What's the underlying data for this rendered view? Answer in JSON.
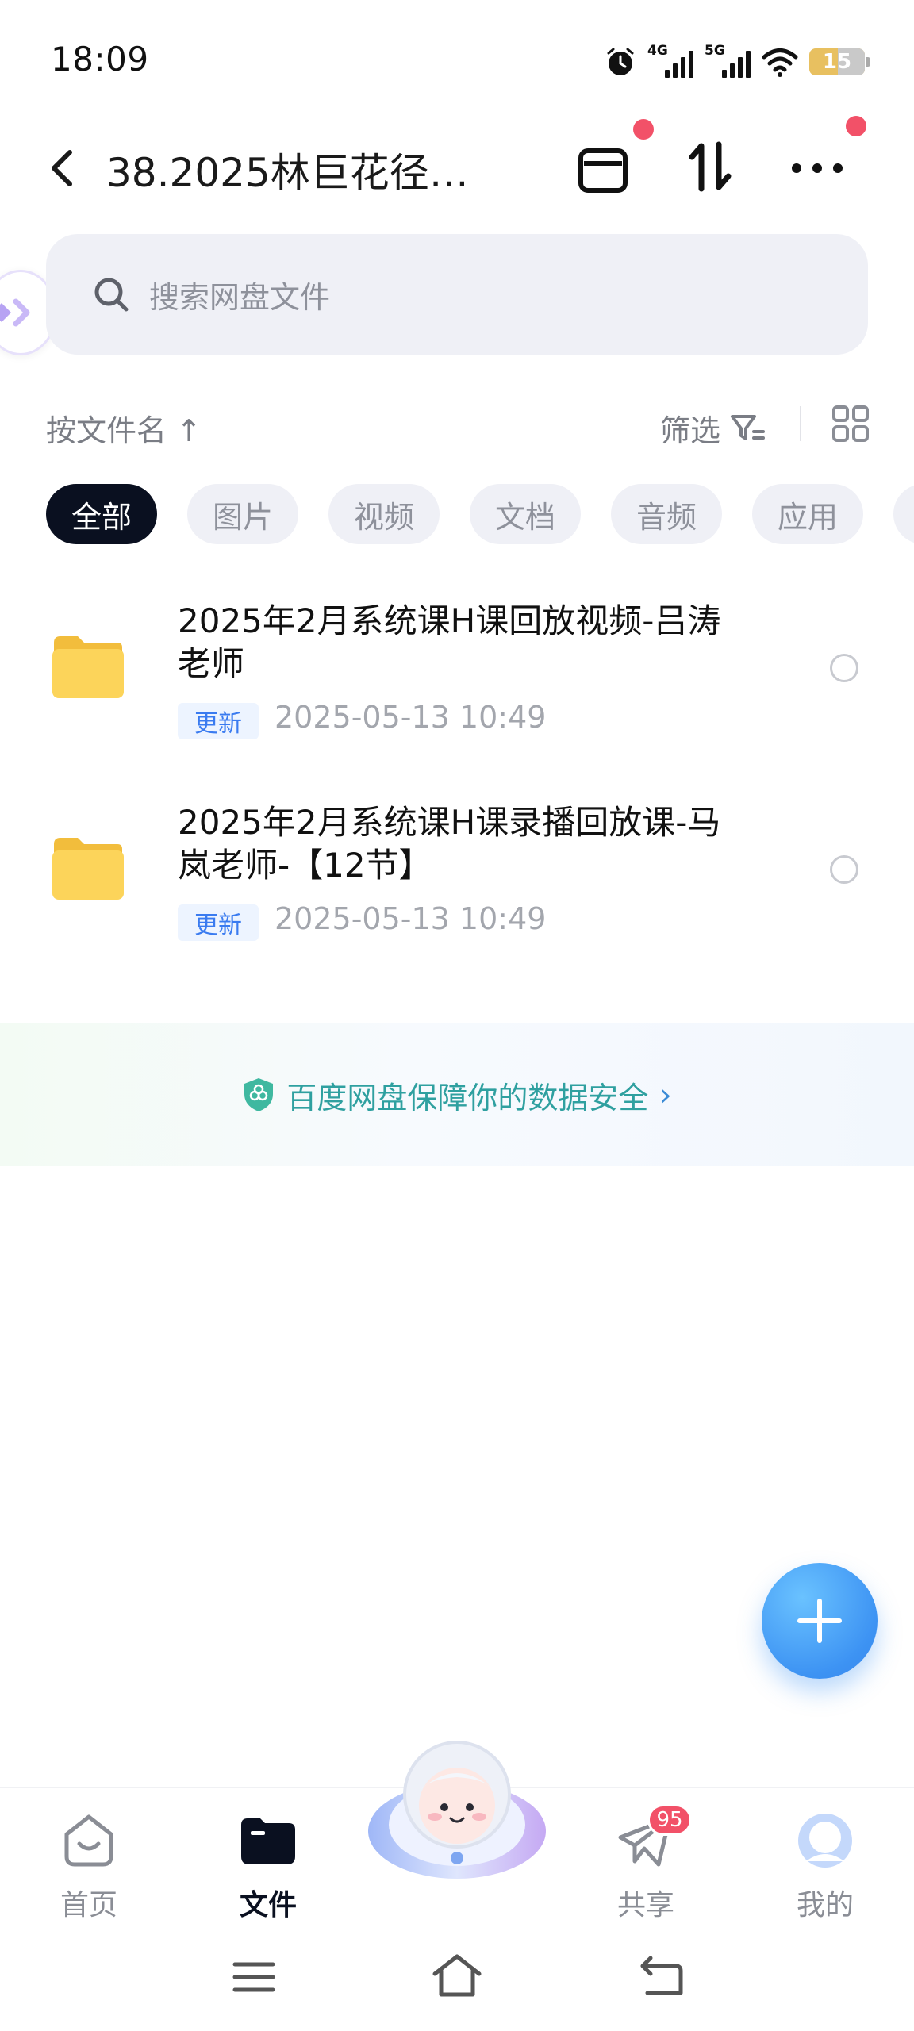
{
  "status_bar": {
    "time": "18:09",
    "signal_1_tag": "4G",
    "signal_2_tag": "5G",
    "battery": "15"
  },
  "header": {
    "title": "38.2025林巨花径…"
  },
  "search": {
    "placeholder": "搜索网盘文件"
  },
  "toolbar": {
    "sort_label": "按文件名 ↑",
    "filter_label": "筛选"
  },
  "chips": [
    {
      "label": "全部",
      "active": true
    },
    {
      "label": "图片",
      "active": false
    },
    {
      "label": "视频",
      "active": false
    },
    {
      "label": "文档",
      "active": false
    },
    {
      "label": "音频",
      "active": false
    },
    {
      "label": "应用",
      "active": false
    }
  ],
  "files": [
    {
      "name_line1": "2025年2月系统课H课回放视频-吕涛",
      "name_line2": "老师",
      "badge": "更新",
      "time": "2025-05-13  10:49"
    },
    {
      "name_line1": "2025年2月系统课H课录播回放课-马",
      "name_line2": "岚老师-【12节】",
      "badge": "更新",
      "time": "2025-05-13  10:49"
    }
  ],
  "security_banner": {
    "text": "百度网盘保障你的数据安全",
    "chevron": "›"
  },
  "bottom_nav": {
    "home": "首页",
    "files": "文件",
    "share": "共享",
    "share_badge": "95",
    "mine": "我的"
  },
  "colors": {
    "accent": "#3d93f3",
    "badge_red": "#f25168",
    "active_chip": "#0a1020",
    "folder_yellow": "#fcd45a"
  }
}
